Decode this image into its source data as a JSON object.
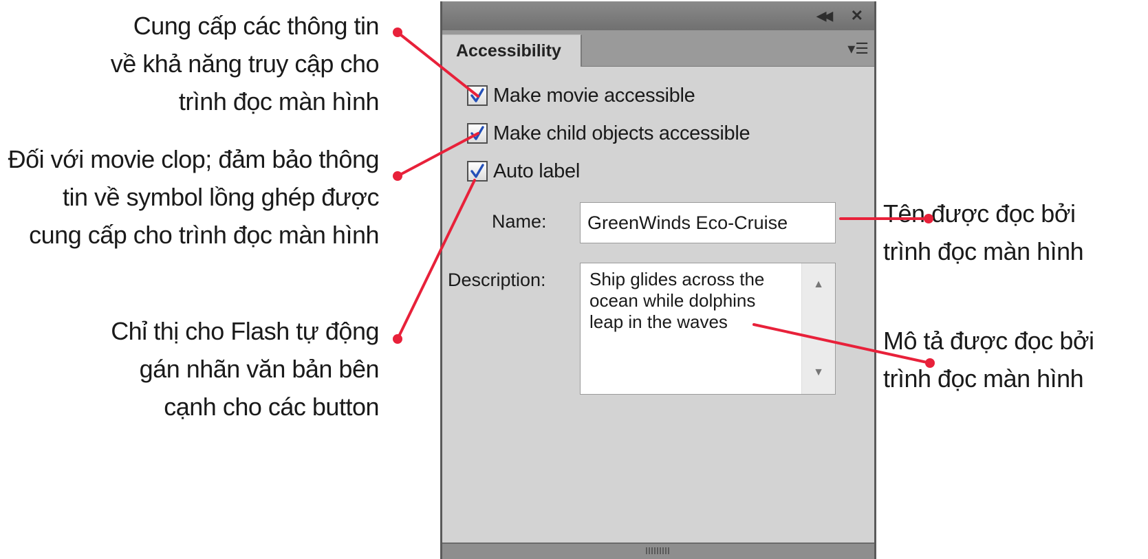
{
  "annotations": {
    "left": [
      {
        "lines": [
          "Cung cấp các thông tin",
          "về khả năng truy cập cho",
          "trình đọc màn hình"
        ]
      },
      {
        "lines": [
          "Đối với movie clop; đảm bảo thông",
          "tin về symbol lồng ghép được",
          "cung cấp cho trình đọc màn hình"
        ]
      },
      {
        "lines": [
          "Chỉ thị cho Flash tự động",
          "gán nhãn văn bản bên",
          "cạnh cho các button"
        ]
      }
    ],
    "right": [
      {
        "lines": [
          "Tên được đọc bởi",
          "trình đọc màn hình"
        ]
      },
      {
        "lines": [
          "Mô tả được đọc bởi",
          "trình đọc màn hình"
        ]
      }
    ],
    "leader_color": "#e8213a"
  },
  "panel": {
    "titlebar": {
      "collapse_icon": "double-chevron-left-icon",
      "close_icon": "close-icon"
    },
    "tab_label": "Accessibility",
    "menu_icon": "panel-menu-icon",
    "checkboxes": [
      {
        "label": "Make movie accessible",
        "checked": true
      },
      {
        "label": "Make child objects accessible",
        "checked": true
      },
      {
        "label": "Auto label",
        "checked": true
      }
    ],
    "name_label": "Name:",
    "name_value": "GreenWinds Eco-Cruise",
    "description_label": "Description:",
    "description_value": "Ship glides across the ocean while dolphins leap in the waves"
  }
}
